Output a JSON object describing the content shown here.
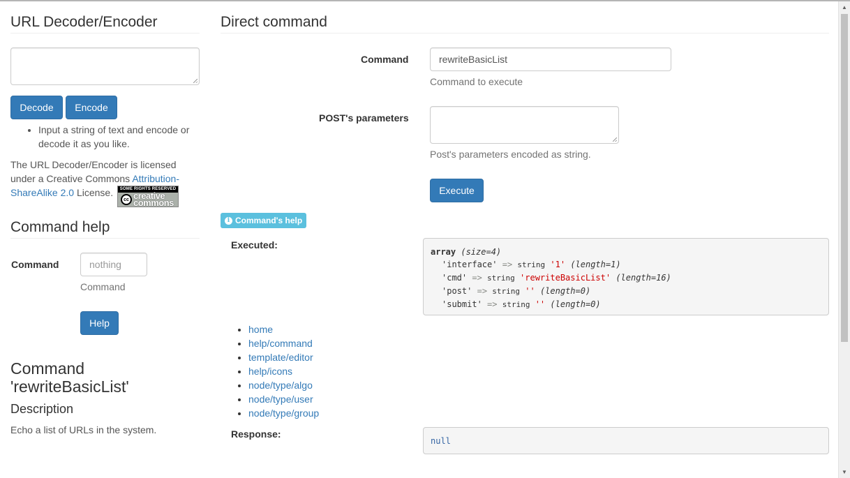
{
  "left": {
    "decoder": {
      "title": "URL Decoder/Encoder",
      "decode_label": "Decode",
      "encode_label": "Encode",
      "tip": "Input a string of text and encode or decode it as you like.",
      "license_prefix": "The URL Decoder/Encoder is licensed under a Creative Commons ",
      "license_link": "Attribution-ShareAlike 2.0",
      "license_suffix": " License.",
      "cc_top": "SOME RIGHTS RESERVED",
      "cc_bottom": "creative commons"
    },
    "command_help": {
      "title": "Command help",
      "command_label": "Command",
      "command_placeholder": "nothing",
      "command_help_text": "Command",
      "help_label": "Help"
    },
    "command_doc": {
      "title": "Command 'rewriteBasicList'",
      "description_title": "Description",
      "description": "Echo a list of URLs in the system."
    }
  },
  "main": {
    "title": "Direct command",
    "command_label": "Command",
    "command_value": "rewriteBasicList",
    "command_help": "Command to execute",
    "post_label": "POST's parameters",
    "post_help": "Post's parameters encoded as string.",
    "execute_label": "Execute",
    "help_badge": "Command's help",
    "executed_label": "Executed:",
    "response_label": "Response:",
    "dump": {
      "header_type": "array",
      "header_meta": "(size=4)",
      "rows": [
        {
          "key": "'interface'",
          "type": "string",
          "value": "'1'",
          "meta": "(length=1)"
        },
        {
          "key": "'cmd'",
          "type": "string",
          "value": "'rewriteBasicList'",
          "meta": "(length=16)"
        },
        {
          "key": "'post'",
          "type": "string",
          "value": "''",
          "meta": "(length=0)"
        },
        {
          "key": "'submit'",
          "type": "string",
          "value": "''",
          "meta": "(length=0)"
        }
      ],
      "arrow": "=>"
    },
    "links": [
      "home",
      "help/command",
      "template/editor",
      "help/icons",
      "node/type/algo",
      "node/type/user",
      "node/type/group"
    ],
    "response_value": "null"
  },
  "colors": {
    "primary": "#337ab7",
    "info": "#5bc0de",
    "string_value": "#cc0000"
  }
}
